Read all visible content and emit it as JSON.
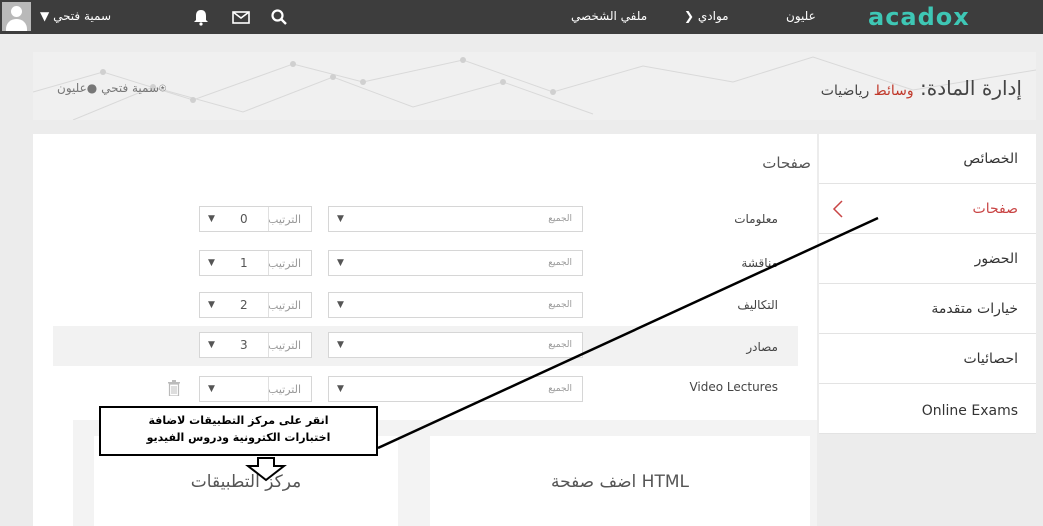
{
  "topbar": {
    "logo": "acadox",
    "nav": [
      "عليون",
      "موادي",
      "ملفي الشخصي"
    ],
    "user_name": "سمية فتحي"
  },
  "banner": {
    "title_prefix": "إدارة المادة:",
    "course_red": "وسائط",
    "course_rest": "رياضيات",
    "owner_name": "سمية فتحي",
    "owner_org": "عليون"
  },
  "sidemenu": {
    "items": [
      {
        "label": "الخصائص"
      },
      {
        "label": "صفحات"
      },
      {
        "label": "الحضور"
      },
      {
        "label": "خيارات متقدمة"
      },
      {
        "label": "احصائيات"
      },
      {
        "label": "Online Exams"
      }
    ]
  },
  "pages": {
    "title": "صفحات",
    "audience_placeholder": "الجميع",
    "order_label": "الترتيب",
    "rows": [
      {
        "label": "معلومات",
        "order": "0"
      },
      {
        "label": "مناقشة",
        "order": "1"
      },
      {
        "label": "التكاليف",
        "order": "2"
      },
      {
        "label": "مصادر",
        "order": "3"
      },
      {
        "label": "Video Lectures",
        "order": ""
      }
    ]
  },
  "cards": {
    "add_html": "اضف صفحة HTML",
    "app_center": "مركز التطبيقات"
  },
  "callout": {
    "line1": "انقر على مركز التطبيقات لاضافة",
    "line2": "اختبارات الكترونية ودروس الفيديو"
  },
  "colors": {
    "topbar": "#3d3d3d",
    "logo": "#3ec7b5",
    "active": "#c94545"
  }
}
